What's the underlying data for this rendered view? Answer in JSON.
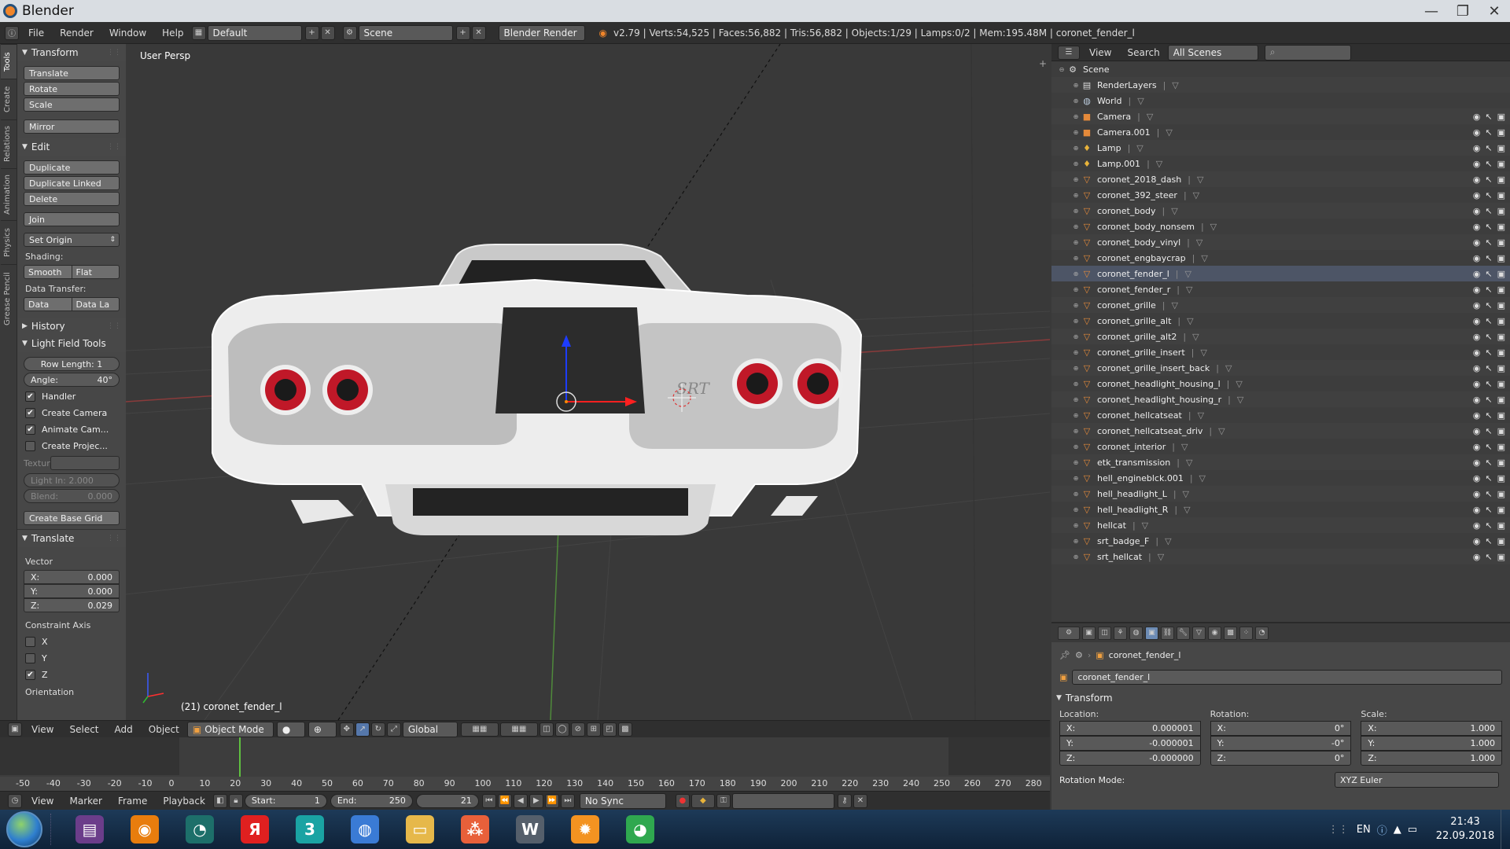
{
  "window": {
    "title": "Blender",
    "controls": [
      "—",
      "❐",
      "✕"
    ]
  },
  "infobar": {
    "menus": [
      "File",
      "Render",
      "Window",
      "Help"
    ],
    "screen_layout": "Default",
    "scene": "Scene",
    "engine": "Blender Render",
    "stats": "v2.79 | Verts:54,525 | Faces:56,882 | Tris:56,882 | Objects:1/29 | Lamps:0/2 | Mem:195.48M | coronet_fender_l"
  },
  "tool_tabs": [
    "Tools",
    "Create",
    "Relations",
    "Animation",
    "Physics",
    "Grease Pencil"
  ],
  "tool_shelf": {
    "transform": {
      "title": "Transform",
      "buttons": [
        "Translate",
        "Rotate",
        "Scale",
        "Mirror"
      ]
    },
    "edit": {
      "title": "Edit",
      "buttons": [
        "Duplicate",
        "Duplicate Linked",
        "Delete",
        "Join"
      ],
      "set_origin": "Set Origin",
      "shading_label": "Shading:",
      "smooth": "Smooth",
      "flat": "Flat",
      "data_transfer_label": "Data Transfer:",
      "data": "Data",
      "data_la": "Data La"
    },
    "history": {
      "title": "History"
    },
    "lft": {
      "title": "Light Field Tools",
      "row_length": "Row Length: 1",
      "angle_label": "Angle:",
      "angle_val": "40°",
      "handler": "Handler",
      "create_camera": "Create Camera",
      "animate_cam": "Animate Cam...",
      "create_projec": "Create Projec...",
      "textur": "Textur",
      "light_in": "Light In: 2.000",
      "blend": "Blend:",
      "blend_val": "0.000",
      "create_base_grid": "Create Base Grid"
    },
    "translate_op": {
      "title": "Translate",
      "vector_label": "Vector",
      "x": "X:",
      "x_val": "0.000",
      "y": "Y:",
      "y_val": "0.000",
      "z": "Z:",
      "z_val": "0.029",
      "constraint_label": "Constraint Axis",
      "cx": "X",
      "cy": "Y",
      "cz": "Z",
      "orientation_label": "Orientation"
    }
  },
  "viewport": {
    "label": "User Persp",
    "object_label": "(21) coronet_fender_l",
    "badge": "SRT"
  },
  "view3d_header": {
    "menus": [
      "View",
      "Select",
      "Add",
      "Object"
    ],
    "mode": "Object Mode",
    "orientation": "Global"
  },
  "timeline": {
    "ticks": [
      "-50",
      "-40",
      "-30",
      "-20",
      "-10",
      "0",
      "10",
      "20",
      "30",
      "40",
      "50",
      "60",
      "70",
      "80",
      "90",
      "100",
      "110",
      "120",
      "130",
      "140",
      "150",
      "160",
      "170",
      "180",
      "190",
      "200",
      "210",
      "220",
      "230",
      "240",
      "250",
      "260",
      "270",
      "280"
    ],
    "current_frame": 21,
    "menus": [
      "View",
      "Marker",
      "Frame",
      "Playback"
    ],
    "start_label": "Start:",
    "start_val": "1",
    "end_label": "End:",
    "end_val": "250",
    "frame_val": "21",
    "sync": "No Sync"
  },
  "outliner": {
    "menus": [
      "View",
      "Search"
    ],
    "filter": "All Scenes",
    "rows": [
      {
        "name": "Scene",
        "icon": "scene-icon",
        "level": 0
      },
      {
        "name": "RenderLayers",
        "icon": "renderlayers-icon",
        "level": 1
      },
      {
        "name": "World",
        "icon": "world-icon",
        "level": 1
      },
      {
        "name": "Camera",
        "icon": "camera-icon",
        "level": 1
      },
      {
        "name": "Camera.001",
        "icon": "camera-icon",
        "level": 1
      },
      {
        "name": "Lamp",
        "icon": "lamp-icon",
        "level": 1
      },
      {
        "name": "Lamp.001",
        "icon": "lamp-icon",
        "level": 1
      },
      {
        "name": "coronet_2018_dash",
        "icon": "mesh-icon",
        "level": 1
      },
      {
        "name": "coronet_392_steer",
        "icon": "mesh-icon",
        "level": 1
      },
      {
        "name": "coronet_body",
        "icon": "mesh-icon",
        "level": 1
      },
      {
        "name": "coronet_body_nonsem",
        "icon": "mesh-icon",
        "level": 1
      },
      {
        "name": "coronet_body_vinyl",
        "icon": "mesh-icon",
        "level": 1
      },
      {
        "name": "coronet_engbaycrap",
        "icon": "mesh-icon",
        "level": 1
      },
      {
        "name": "coronet_fender_l",
        "icon": "mesh-icon",
        "level": 1
      },
      {
        "name": "coronet_fender_r",
        "icon": "mesh-icon",
        "level": 1
      },
      {
        "name": "coronet_grille",
        "icon": "mesh-icon",
        "level": 1
      },
      {
        "name": "coronet_grille_alt",
        "icon": "mesh-icon",
        "level": 1
      },
      {
        "name": "coronet_grille_alt2",
        "icon": "mesh-icon",
        "level": 1
      },
      {
        "name": "coronet_grille_insert",
        "icon": "mesh-icon",
        "level": 1
      },
      {
        "name": "coronet_grille_insert_back",
        "icon": "mesh-icon",
        "level": 1
      },
      {
        "name": "coronet_headlight_housing_l",
        "icon": "mesh-icon",
        "level": 1
      },
      {
        "name": "coronet_headlight_housing_r",
        "icon": "mesh-icon",
        "level": 1
      },
      {
        "name": "coronet_hellcatseat",
        "icon": "mesh-icon",
        "level": 1
      },
      {
        "name": "coronet_hellcatseat_driv",
        "icon": "mesh-icon",
        "level": 1
      },
      {
        "name": "coronet_interior",
        "icon": "mesh-icon",
        "level": 1
      },
      {
        "name": "etk_transmission",
        "icon": "mesh-icon",
        "level": 1
      },
      {
        "name": "hell_engineblck.001",
        "icon": "mesh-icon",
        "level": 1
      },
      {
        "name": "hell_headlight_L",
        "icon": "mesh-icon",
        "level": 1
      },
      {
        "name": "hell_headlight_R",
        "icon": "mesh-icon",
        "level": 1
      },
      {
        "name": "hellcat",
        "icon": "mesh-icon",
        "level": 1
      },
      {
        "name": "srt_badge_F",
        "icon": "mesh-icon",
        "level": 1
      },
      {
        "name": "srt_hellcat",
        "icon": "mesh-icon",
        "level": 1
      }
    ]
  },
  "properties": {
    "breadcrumb": "coronet_fender_l",
    "object_name": "coronet_fender_l",
    "transform_title": "Transform",
    "location_label": "Location:",
    "rotation_label": "Rotation:",
    "scale_label": "Scale:",
    "loc": [
      {
        "a": "X:",
        "v": "0.000001"
      },
      {
        "a": "Y:",
        "v": "-0.000001"
      },
      {
        "a": "Z:",
        "v": "-0.000000"
      }
    ],
    "rot": [
      {
        "a": "X:",
        "v": "0°"
      },
      {
        "a": "Y:",
        "v": "-0°"
      },
      {
        "a": "Z:",
        "v": "0°"
      }
    ],
    "scl": [
      {
        "a": "X:",
        "v": "1.000"
      },
      {
        "a": "Y:",
        "v": "1.000"
      },
      {
        "a": "Z:",
        "v": "1.000"
      }
    ],
    "rotation_mode_label": "Rotation Mode:",
    "rotation_mode": "XYZ Euler"
  },
  "taskbar": {
    "apps": [
      {
        "name": "winrar",
        "glyph": "▤",
        "color": "#6b3d8a"
      },
      {
        "name": "blender",
        "glyph": "◉",
        "color": "#e87d0d"
      },
      {
        "name": "speedometer",
        "glyph": "◔",
        "color": "#1d6f6a"
      },
      {
        "name": "yandex",
        "glyph": "Я",
        "color": "#e02020"
      },
      {
        "name": "3dsmax",
        "glyph": "3",
        "color": "#1aa3a3"
      },
      {
        "name": "browser",
        "glyph": "◍",
        "color": "#3a7bd5"
      },
      {
        "name": "explorer",
        "glyph": "▭",
        "color": "#e6b84a"
      },
      {
        "name": "nodes",
        "glyph": "⁂",
        "color": "#e8603a"
      },
      {
        "name": "wps",
        "glyph": "W",
        "color": "#555f6b"
      },
      {
        "name": "settings",
        "glyph": "✹",
        "color": "#f39321"
      },
      {
        "name": "download",
        "glyph": "◕",
        "color": "#2fa84f"
      }
    ],
    "lang": "EN",
    "time": "21:43",
    "date": "22.09.2018"
  }
}
